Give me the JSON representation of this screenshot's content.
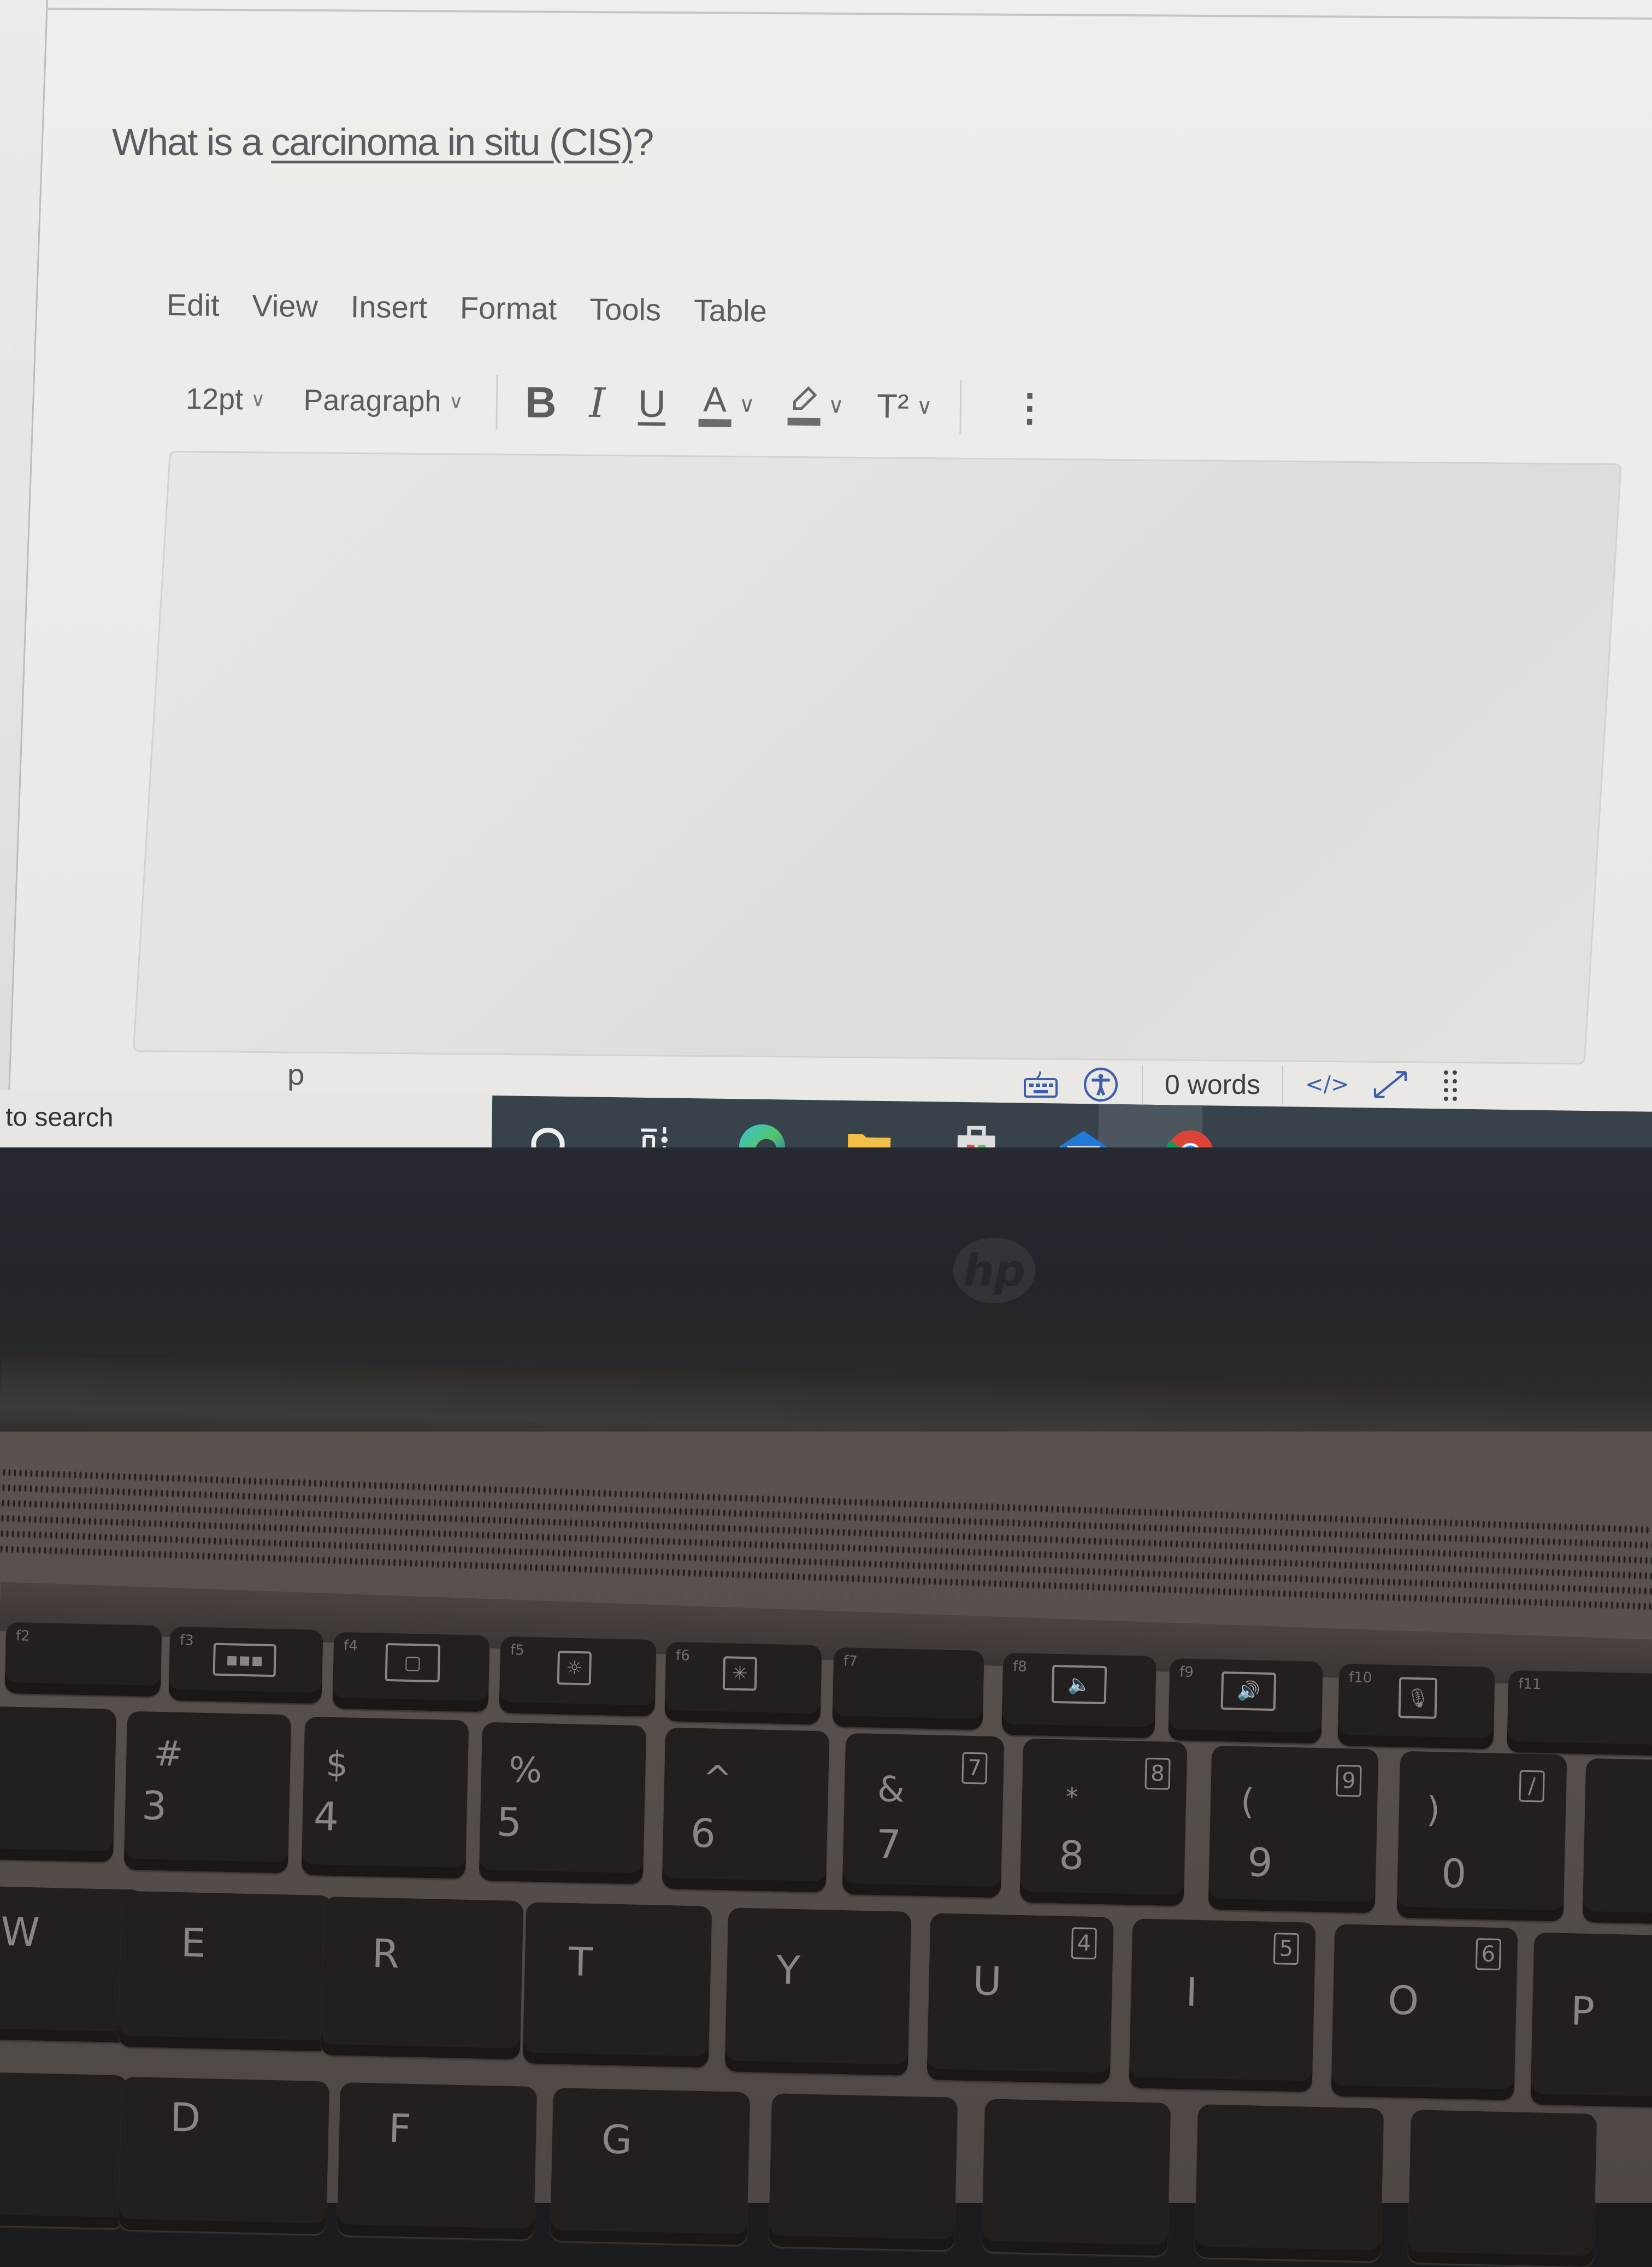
{
  "question": {
    "prefix": "What is a ",
    "link_text": "carcinoma in situ (CIS)",
    "suffix": "?"
  },
  "editor": {
    "menu": [
      "Edit",
      "View",
      "Insert",
      "Format",
      "Tools",
      "Table"
    ],
    "font_size": "12pt",
    "block_format": "Paragraph",
    "buttons": {
      "bold": "B",
      "italic": "I",
      "underline": "U",
      "text_color": "A",
      "superscript": "T²",
      "more": "⋮"
    },
    "body_text": "",
    "status": {
      "element_path": "p",
      "word_count": "0 words",
      "html_toggle": "</>"
    }
  },
  "taskbar": {
    "search_placeholder": "to search",
    "apps": [
      "cortana",
      "task-view",
      "edge",
      "file-explorer",
      "microsoft-store",
      "mail",
      "chrome"
    ],
    "active_app": "chrome"
  },
  "laptop": {
    "brand": "hp",
    "function_keys": [
      {
        "label": "f2",
        "icon": ""
      },
      {
        "label": "f3",
        "icon": "keyboard-backlight"
      },
      {
        "label": "f4",
        "icon": "display-switch"
      },
      {
        "label": "f5",
        "icon": "brightness-down"
      },
      {
        "label": "f6",
        "icon": "brightness-up"
      },
      {
        "label": "f7",
        "icon": ""
      },
      {
        "label": "f8",
        "icon": "volume-down"
      },
      {
        "label": "f9",
        "icon": "volume-up"
      },
      {
        "label": "f10",
        "icon": "mic-mute"
      },
      {
        "label": "f11",
        "icon": ""
      }
    ],
    "number_keys": [
      {
        "main": "3",
        "shift": "#",
        "numpad": ""
      },
      {
        "main": "4",
        "shift": "$",
        "numpad": ""
      },
      {
        "main": "5",
        "shift": "%",
        "numpad": ""
      },
      {
        "main": "6",
        "shift": "^",
        "numpad": ""
      },
      {
        "main": "7",
        "shift": "&",
        "numpad": "7"
      },
      {
        "main": "8",
        "shift": "*",
        "numpad": "8"
      },
      {
        "main": "9",
        "shift": "(",
        "numpad": "9"
      },
      {
        "main": "0",
        "shift": ")",
        "numpad": "/"
      }
    ],
    "letter_row": [
      {
        "main": "W",
        "numpad": ""
      },
      {
        "main": "E",
        "numpad": ""
      },
      {
        "main": "R",
        "numpad": ""
      },
      {
        "main": "T",
        "numpad": ""
      },
      {
        "main": "Y",
        "numpad": ""
      },
      {
        "main": "U",
        "numpad": "4"
      },
      {
        "main": "I",
        "numpad": "5"
      },
      {
        "main": "O",
        "numpad": "6"
      },
      {
        "main": "P",
        "numpad": ""
      }
    ],
    "home_row_partial": [
      "D",
      "F",
      "G"
    ]
  }
}
